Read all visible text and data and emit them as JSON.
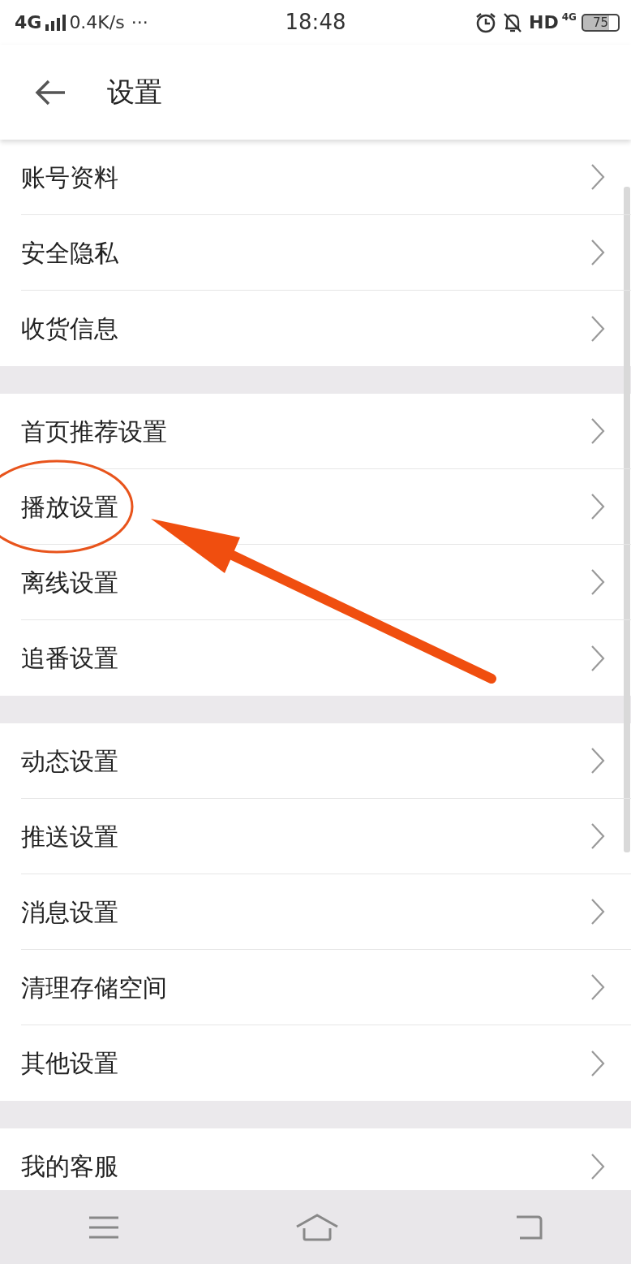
{
  "status_bar": {
    "network": "4G",
    "speed": "0.4K/s",
    "more": "···",
    "time": "18:48",
    "hd": "HD",
    "network_small": "4G",
    "battery": "75"
  },
  "header": {
    "title": "设置"
  },
  "groups": [
    {
      "items": [
        {
          "label": "账号资料",
          "highlighted": false
        },
        {
          "label": "安全隐私",
          "highlighted": false
        },
        {
          "label": "收货信息",
          "highlighted": false
        }
      ]
    },
    {
      "items": [
        {
          "label": "首页推荐设置",
          "highlighted": false
        },
        {
          "label": "播放设置",
          "highlighted": true
        },
        {
          "label": "离线设置",
          "highlighted": false
        },
        {
          "label": "追番设置",
          "highlighted": false
        }
      ]
    },
    {
      "items": [
        {
          "label": "动态设置",
          "highlighted": false
        },
        {
          "label": "推送设置",
          "highlighted": false
        },
        {
          "label": "消息设置",
          "highlighted": false
        },
        {
          "label": "清理存储空间",
          "highlighted": false
        },
        {
          "label": "其他设置",
          "highlighted": false
        }
      ]
    },
    {
      "items": [
        {
          "label": "我的客服",
          "highlighted": false
        }
      ]
    }
  ]
}
